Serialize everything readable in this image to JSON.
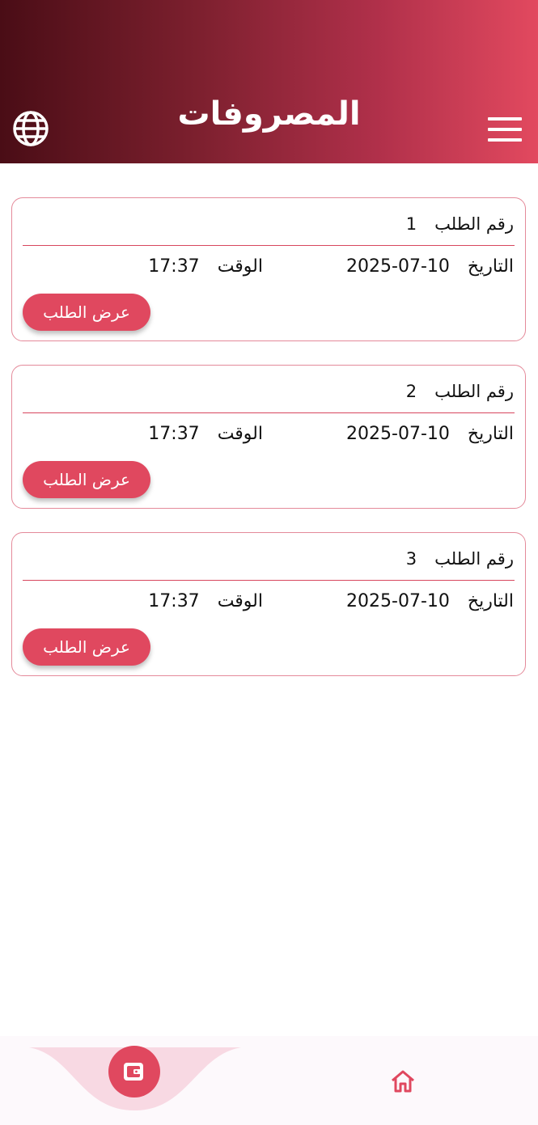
{
  "header": {
    "title": "المصروفات",
    "menu_icon": "hamburger-menu-icon",
    "language_icon": "globe-icon"
  },
  "colors": {
    "accent": "#e0485f",
    "header_gradient_start": "#4a0d16",
    "header_gradient_end": "#e2495f"
  },
  "orders": [
    {
      "order_label": "رقم الطلب",
      "order_number": "1",
      "date_label": "التاريخ",
      "date": "2025-07-10",
      "time_label": "الوقت",
      "time": "17:37",
      "button_label": "عرض الطلب"
    },
    {
      "order_label": "رقم الطلب",
      "order_number": "2",
      "date_label": "التاريخ",
      "date": "2025-07-10",
      "time_label": "الوقت",
      "time": "17:37",
      "button_label": "عرض الطلب"
    },
    {
      "order_label": "رقم الطلب",
      "order_number": "3",
      "date_label": "التاريخ",
      "date": "2025-07-10",
      "time_label": "الوقت",
      "time": "17:37",
      "button_label": "عرض الطلب"
    }
  ],
  "bottom_nav": {
    "items": [
      {
        "icon": "wallet-icon",
        "active": true
      },
      {
        "icon": "home-icon",
        "active": false
      }
    ]
  }
}
